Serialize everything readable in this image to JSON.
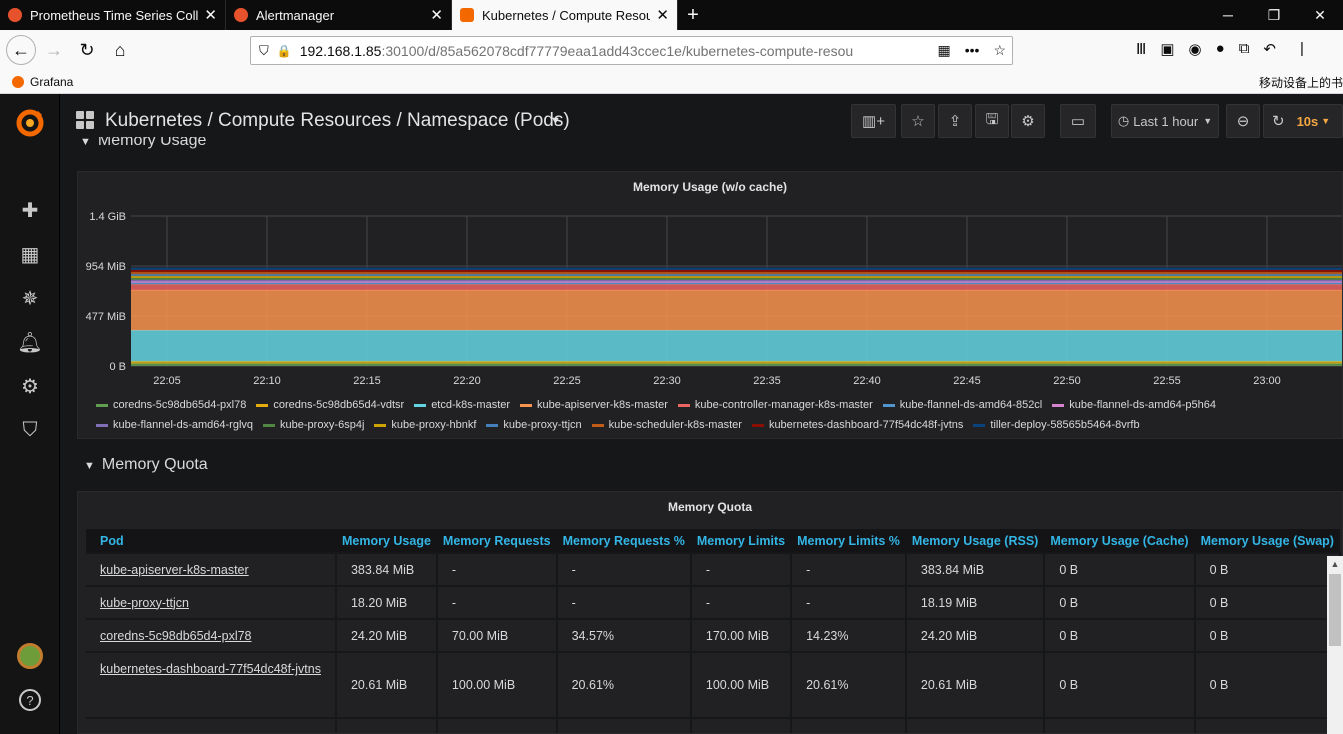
{
  "browser": {
    "tabs": [
      {
        "label": "Prometheus Time Series Coll",
        "active": false
      },
      {
        "label": "Alertmanager",
        "active": false
      },
      {
        "label": "Kubernetes / Compute Resou",
        "active": true
      }
    ],
    "url_host": "192.168.1.85",
    "url_rest": ":30100/d/85a562078cdf77779eaa1add43ccec1e/kubernetes-compute-resou",
    "bookmark": "Grafana",
    "mobile_bookmarks": "移动设备上的书"
  },
  "dashboard": {
    "title": "Kubernetes / Compute Resources / Namespace (Pods)",
    "time_range": "Last 1 hour",
    "refresh": "10s"
  },
  "row1": {
    "title": "Memory Usage"
  },
  "panel1": {
    "title": "Memory Usage (w/o cache)"
  },
  "chart_data": {
    "type": "area",
    "title": "Memory Usage (w/o cache)",
    "stacked": true,
    "y_ticks": [
      "0 B",
      "477 MiB",
      "954 MiB",
      "1.4 GiB"
    ],
    "ylim_mib": [
      0,
      1431
    ],
    "x_ticks": [
      "22:05",
      "22:10",
      "22:15",
      "22:20",
      "22:25",
      "22:30",
      "22:35",
      "22:40",
      "22:45",
      "22:50",
      "22:55",
      "23:00"
    ],
    "series": [
      {
        "name": "coredns-5c98db65d4-pxl78",
        "color": "#629e51",
        "value_mib": 24.2
      },
      {
        "name": "coredns-5c98db65d4-vdtsr",
        "color": "#e5ac0e",
        "value_mib": 20
      },
      {
        "name": "etcd-k8s-master",
        "color": "#64d5e2",
        "value_mib": 296
      },
      {
        "name": "kube-apiserver-k8s-master",
        "color": "#f9934e",
        "value_mib": 384
      },
      {
        "name": "kube-controller-manager-k8s-master",
        "color": "#ea6460",
        "value_mib": 55
      },
      {
        "name": "kube-flannel-ds-amd64-852cl",
        "color": "#5195ce",
        "value_mib": 14
      },
      {
        "name": "kube-flannel-ds-amd64-p5h64",
        "color": "#d683ce",
        "value_mib": 14
      },
      {
        "name": "kube-flannel-ds-amd64-rglvq",
        "color": "#806eb7",
        "value_mib": 14
      },
      {
        "name": "kube-proxy-6sp4j",
        "color": "#508642",
        "value_mib": 18
      },
      {
        "name": "kube-proxy-hbnkf",
        "color": "#cca300",
        "value_mib": 18
      },
      {
        "name": "kube-proxy-ttjcn",
        "color": "#447ebc",
        "value_mib": 18.2
      },
      {
        "name": "kube-scheduler-k8s-master",
        "color": "#c15c17",
        "value_mib": 20
      },
      {
        "name": "kubernetes-dashboard-77f54dc48f-jvtns",
        "color": "#890f02",
        "value_mib": 20.6
      },
      {
        "name": "tiller-deploy-58565b5464-8vrfb",
        "color": "#0a437c",
        "value_mib": 18
      }
    ]
  },
  "row2": {
    "title": "Memory Quota"
  },
  "panel2": {
    "title": "Memory Quota"
  },
  "table": {
    "headers": [
      "Pod",
      "Memory Usage",
      "Memory Requests",
      "Memory Requests %",
      "Memory Limits",
      "Memory Limits %",
      "Memory Usage (RSS)",
      "Memory Usage (Cache)",
      "Memory Usage (Swap)"
    ],
    "rows": [
      [
        "kube-apiserver-k8s-master",
        "383.84 MiB",
        "-",
        "-",
        "-",
        "-",
        "383.84 MiB",
        "0 B",
        "0 B"
      ],
      [
        "kube-proxy-ttjcn",
        "18.20 MiB",
        "-",
        "-",
        "-",
        "-",
        "18.19 MiB",
        "0 B",
        "0 B"
      ],
      [
        "coredns-5c98db65d4-pxl78",
        "24.20 MiB",
        "70.00 MiB",
        "34.57%",
        "170.00 MiB",
        "14.23%",
        "24.20 MiB",
        "0 B",
        "0 B"
      ],
      [
        "kubernetes-dashboard-77f54dc48f-jvtns",
        "20.61 MiB",
        "100.00 MiB",
        "20.61%",
        "100.00 MiB",
        "20.61%",
        "20.61 MiB",
        "0 B",
        "0 B"
      ]
    ]
  }
}
